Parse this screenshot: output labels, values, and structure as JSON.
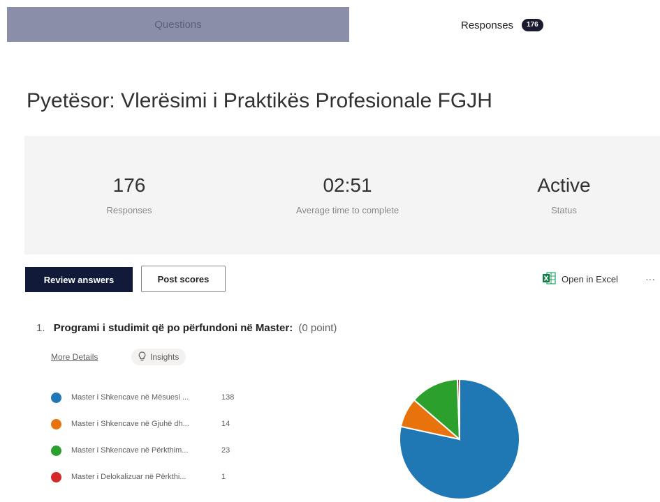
{
  "tabs": {
    "questions_label": "Questions",
    "responses_label": "Responses",
    "responses_badge": "176"
  },
  "form": {
    "title": "Pyetësor: Vlerësimi i Praktikës Profesionale FGJH"
  },
  "stats": {
    "responses_value": "176",
    "responses_label": "Responses",
    "avg_time_value": "02:51",
    "avg_time_label": "Average time to complete",
    "status_value": "Active",
    "status_label": "Status"
  },
  "actions": {
    "review_label": "Review answers",
    "post_scores_label": "Post scores",
    "excel_label": "Open in Excel",
    "more_label": "···"
  },
  "question": {
    "number": "1.",
    "text": "Programi i studimit që po përfundoni në Master:",
    "points": "(0 point)",
    "more_details_label": "More Details",
    "insights_label": "Insights"
  },
  "chart_data": {
    "type": "pie",
    "categories": [
      "Master i Shkencave në Mësuesi ...",
      "Master i Shkencave në Gjuhë dh...",
      "Master i Shkencave në Përkthim...",
      "Master i Delokalizuar në Përkthi..."
    ],
    "values": [
      138,
      14,
      23,
      1
    ],
    "colors": [
      "#1f77b4",
      "#e8730c",
      "#2ca02c",
      "#d62728"
    ]
  }
}
